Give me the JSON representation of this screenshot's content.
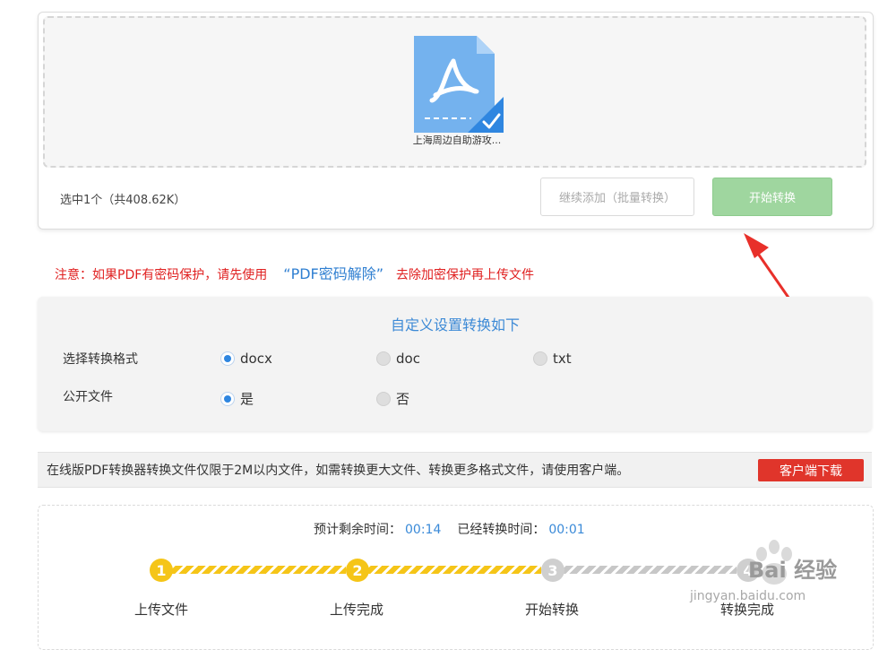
{
  "upload": {
    "file_name": "上海周边自助游攻...",
    "selected_info": "选中1个（共408.62K）",
    "add_more_label": "继续添加（批量转换）",
    "start_label": "开始转换"
  },
  "notice": {
    "prefix": "注意：如果PDF有密码保护，请先使用",
    "link": "“PDF密码解除”",
    "suffix": "去除加密保护再上传文件"
  },
  "settings": {
    "title": "自定义设置转换如下",
    "format_label": "选择转换格式",
    "formats": [
      {
        "label": "docx",
        "selected": true
      },
      {
        "label": "doc",
        "selected": false
      },
      {
        "label": "txt",
        "selected": false
      }
    ],
    "public_label": "公开文件",
    "public_options": [
      {
        "label": "是",
        "selected": true
      },
      {
        "label": "否",
        "selected": false
      }
    ]
  },
  "promo": {
    "text": "在线版PDF转换器转换文件仅限于2M以内文件，如需转换更大文件、转换更多格式文件，请使用客户端。",
    "button": "客户端下载"
  },
  "progress": {
    "remaining_label": "预计剩余时间：",
    "remaining_value": "00:14",
    "elapsed_label": "已经转换时间：",
    "elapsed_value": "00:01",
    "steps": [
      {
        "num": "1",
        "label": "上传文件",
        "done": true
      },
      {
        "num": "2",
        "label": "上传完成",
        "done": true
      },
      {
        "num": "3",
        "label": "开始转换",
        "done": false
      },
      {
        "num": "4",
        "label": "转换完成",
        "done": false
      }
    ]
  },
  "watermark": {
    "brand": "Bai 经验",
    "url": "jingyan.baidu.com"
  },
  "colors": {
    "accent_blue": "#2f86e0",
    "start_green": "#9fd69f",
    "download_red": "#e0352b",
    "step_yellow": "#f5c518",
    "notice_red": "#e02020"
  }
}
